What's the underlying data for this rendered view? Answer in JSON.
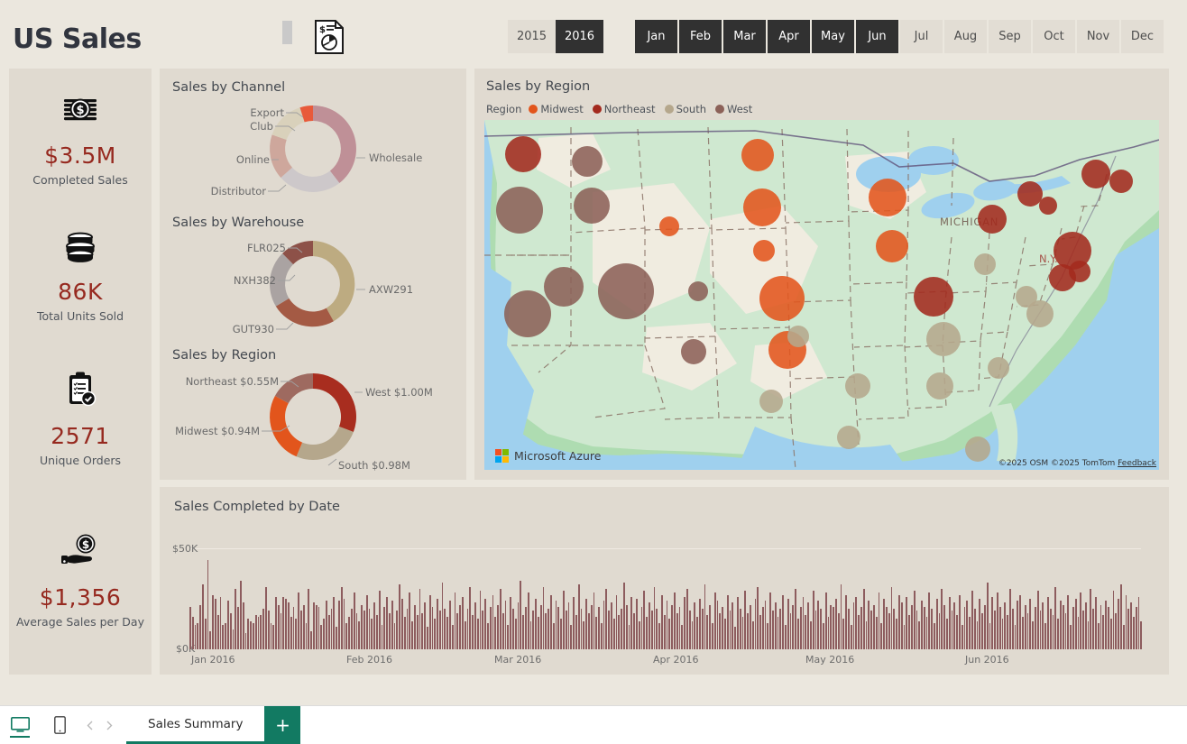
{
  "header": {
    "title": "US Sales",
    "report_icon": "report-document-icon",
    "year_slicer": [
      {
        "label": "2015",
        "selected": false
      },
      {
        "label": "2016",
        "selected": true
      }
    ],
    "month_slicer": [
      {
        "label": "Jan",
        "selected": true
      },
      {
        "label": "Feb",
        "selected": true
      },
      {
        "label": "Mar",
        "selected": true
      },
      {
        "label": "Apr",
        "selected": true
      },
      {
        "label": "May",
        "selected": true
      },
      {
        "label": "Jun",
        "selected": true
      },
      {
        "label": "Jul",
        "selected": false
      },
      {
        "label": "Aug",
        "selected": false
      },
      {
        "label": "Sep",
        "selected": false
      },
      {
        "label": "Oct",
        "selected": false
      },
      {
        "label": "Nov",
        "selected": false
      },
      {
        "label": "Dec",
        "selected": false
      }
    ]
  },
  "kpis": [
    {
      "icon": "money-stack-icon",
      "value": "$3.5M",
      "label": "Completed Sales"
    },
    {
      "icon": "coins-stack-icon",
      "value": "86K",
      "label": "Total Units Sold"
    },
    {
      "icon": "clipboard-check-icon",
      "value": "2571",
      "label": "Unique Orders"
    },
    {
      "icon": "hand-coin-icon",
      "value": "$1,356",
      "label": "Average Sales per Day"
    }
  ],
  "colors": {
    "kpi_value": "#96291f",
    "midwest": "#e2551c",
    "northeast": "#a32a1e",
    "south": "#b5a78c",
    "west": "#8c6158",
    "bar": "#8d5c5e",
    "accent_green": "#127a62",
    "panel_bg": "#e0dad0",
    "page_bg": "#ebe7de",
    "slicer_selected": "#313131"
  },
  "chart_data": [
    {
      "type": "pie",
      "title": "Sales by Channel",
      "legend_position": "callout-labels",
      "categories": [
        "Wholesale",
        "Distributor",
        "Online",
        "Club",
        "Export"
      ],
      "values": [
        44,
        16,
        16,
        15,
        9
      ],
      "colors": [
        "#bf9097",
        "#cdc8ca",
        "#cea79c",
        "#d9d1bb",
        "#e85a3a"
      ],
      "labels": [
        "Wholesale",
        "Distributor",
        "Online",
        "Club",
        "Export"
      ]
    },
    {
      "type": "pie",
      "title": "Sales by Warehouse",
      "legend_position": "callout-labels",
      "categories": [
        "AXW291",
        "GUT930",
        "NXH382",
        "FLR025"
      ],
      "values": [
        46,
        18,
        22,
        14
      ],
      "colors": [
        "#bdab81",
        "#a45a44",
        "#aaa3a2",
        "#8d5148"
      ],
      "labels": [
        "AXW291",
        "GUT930",
        "NXH382",
        "FLR025"
      ]
    },
    {
      "type": "pie",
      "title": "Sales by Region",
      "legend_position": "callout-labels",
      "categories": [
        "West",
        "South",
        "Midwest",
        "Northeast"
      ],
      "values": [
        1.0,
        0.98,
        0.94,
        0.55
      ],
      "unit": "$M",
      "colors": [
        "#a82d1f",
        "#b5a78c",
        "#e2551c",
        "#9e6a60"
      ],
      "labels": [
        "West $1.00M",
        "South $0.98M",
        "Midwest $0.94M",
        "Northeast $0.55M"
      ]
    },
    {
      "type": "bar",
      "title": "Sales Completed by Date",
      "xlabel": "",
      "ylabel": "",
      "ylim": [
        0,
        50000
      ],
      "ytick_labels": [
        "$0K",
        "$50K"
      ],
      "xtick_labels": [
        "Jan 2016",
        "Feb 2016",
        "Mar 2016",
        "Apr 2016",
        "May 2016",
        "Jun 2016"
      ],
      "grid": true,
      "bar_color": "#8d5c5e",
      "values": [
        21,
        16,
        12,
        13,
        22,
        32,
        15,
        44,
        9,
        27,
        25,
        17,
        26,
        12,
        13,
        24,
        18,
        10,
        30,
        21,
        34,
        23,
        8,
        15,
        14,
        13,
        17,
        16,
        17,
        20,
        31,
        19,
        13,
        12,
        26,
        22,
        18,
        26,
        25,
        23,
        16,
        21,
        15,
        28,
        19,
        22,
        13,
        30,
        9,
        23,
        22,
        21,
        12,
        15,
        24,
        17,
        20,
        26,
        11,
        24,
        31,
        25,
        13,
        16,
        20,
        28,
        18,
        14,
        22,
        19,
        27,
        20,
        15,
        23,
        17,
        29,
        12,
        21,
        26,
        18,
        24,
        13,
        19,
        32,
        25,
        16,
        20,
        28,
        14,
        22,
        17,
        30,
        18,
        23,
        11,
        27,
        21,
        15,
        25,
        19,
        33,
        20,
        16,
        24,
        12,
        28,
        18,
        22,
        26,
        14,
        20,
        31,
        17,
        23,
        15,
        29,
        19,
        25,
        13,
        21,
        27,
        16,
        22,
        30,
        18,
        24,
        12,
        26,
        20,
        15,
        23,
        34,
        17,
        21,
        28,
        14,
        19,
        25,
        16,
        22,
        31,
        18,
        20,
        27,
        13,
        24,
        21,
        15,
        29,
        19,
        23,
        12,
        26,
        17,
        32,
        20,
        14,
        25,
        18,
        22,
        28,
        16,
        21,
        13,
        24,
        30,
        19,
        23,
        15,
        27,
        17,
        20,
        33,
        22,
        12,
        26,
        18,
        25,
        14,
        21,
        29,
        16,
        23,
        19,
        31,
        20,
        13,
        27,
        17,
        24,
        15,
        22,
        28,
        18,
        21,
        12,
        26,
        30,
        19,
        14,
        23,
        16,
        25,
        20,
        32,
        17,
        22,
        13,
        28,
        24,
        18,
        21,
        15,
        27,
        19,
        23,
        11,
        26,
        20,
        16,
        29,
        18,
        22,
        14,
        25,
        31,
        17,
        21,
        24,
        13,
        28,
        19,
        23,
        16,
        20,
        27,
        12,
        25,
        18,
        22,
        30,
        15,
        21,
        26,
        17,
        23,
        14,
        29,
        19,
        24,
        20,
        13,
        28,
        16,
        22,
        21,
        25,
        18,
        32,
        15,
        27,
        20,
        12,
        23,
        26,
        17,
        21,
        30,
        14,
        24,
        19,
        22,
        16,
        28,
        13,
        25,
        21,
        18,
        31,
        20,
        15,
        27,
        23,
        12,
        26,
        17,
        22,
        29,
        19,
        14,
        24,
        21,
        16,
        28,
        20,
        13,
        25,
        18,
        30,
        22,
        15,
        26,
        19,
        23,
        17,
        27,
        12,
        21,
        24,
        16,
        29,
        20,
        14,
        25,
        18,
        22,
        33,
        13,
        26,
        19,
        28,
        21,
        15,
        23,
        17,
        30,
        20,
        12,
        24,
        27,
        16,
        22,
        18,
        25,
        14,
        21,
        29,
        19,
        23,
        13,
        26,
        20,
        17,
        31,
        15,
        24,
        22,
        18,
        27,
        12,
        21,
        25,
        16,
        28,
        19,
        23,
        14,
        30,
        20,
        26,
        13,
        22,
        17,
        24,
        21,
        15,
        29,
        18,
        25,
        32,
        12,
        27,
        20,
        23,
        16,
        21,
        26,
        14
      ]
    },
    {
      "type": "scatter",
      "title": "Sales by Region",
      "subtitle": "map",
      "legend_title": "Region",
      "legend": [
        {
          "label": "Midwest",
          "color": "#e2551c"
        },
        {
          "label": "Northeast",
          "color": "#a32a1e"
        },
        {
          "label": "South",
          "color": "#b5a78c"
        },
        {
          "label": "West",
          "color": "#8c6158"
        }
      ],
      "map_labels": [
        "MICHIGAN",
        "N.Y."
      ],
      "brand": "Microsoft Azure",
      "attribution": "©2025 OSM  ©2025 TomTom",
      "feedback_label": "Feedback",
      "bubbles": [
        {
          "x": 43,
          "y": 38,
          "r": 20,
          "region": "Northeast"
        },
        {
          "x": 39,
          "y": 100,
          "r": 26,
          "region": "West"
        },
        {
          "x": 114,
          "y": 46,
          "r": 17,
          "region": "West"
        },
        {
          "x": 119,
          "y": 95,
          "r": 20,
          "region": "West"
        },
        {
          "x": 205,
          "y": 118,
          "r": 11,
          "region": "Midwest"
        },
        {
          "x": 88,
          "y": 185,
          "r": 22,
          "region": "West"
        },
        {
          "x": 48,
          "y": 215,
          "r": 26,
          "region": "West"
        },
        {
          "x": 157,
          "y": 190,
          "r": 31,
          "region": "West"
        },
        {
          "x": 237,
          "y": 190,
          "r": 11,
          "region": "West"
        },
        {
          "x": 232,
          "y": 257,
          "r": 14,
          "region": "West"
        },
        {
          "x": 303,
          "y": 39,
          "r": 18,
          "region": "Midwest"
        },
        {
          "x": 308,
          "y": 97,
          "r": 21,
          "region": "Midwest"
        },
        {
          "x": 310,
          "y": 145,
          "r": 12,
          "region": "Midwest"
        },
        {
          "x": 330,
          "y": 198,
          "r": 25,
          "region": "Midwest"
        },
        {
          "x": 336,
          "y": 255,
          "r": 21,
          "region": "Midwest"
        },
        {
          "x": 318,
          "y": 312,
          "r": 13,
          "region": "South"
        },
        {
          "x": 348,
          "y": 240,
          "r": 12,
          "region": "South"
        },
        {
          "x": 414,
          "y": 295,
          "r": 14,
          "region": "South"
        },
        {
          "x": 404,
          "y": 352,
          "r": 13,
          "region": "South"
        },
        {
          "x": 447,
          "y": 86,
          "r": 21,
          "region": "Midwest"
        },
        {
          "x": 452,
          "y": 140,
          "r": 18,
          "region": "Midwest"
        },
        {
          "x": 498,
          "y": 196,
          "r": 22,
          "region": "Northeast"
        },
        {
          "x": 509,
          "y": 243,
          "r": 19,
          "region": "South"
        },
        {
          "x": 505,
          "y": 295,
          "r": 15,
          "region": "South"
        },
        {
          "x": 555,
          "y": 160,
          "r": 12,
          "region": "South"
        },
        {
          "x": 570,
          "y": 275,
          "r": 12,
          "region": "South"
        },
        {
          "x": 547,
          "y": 365,
          "r": 14,
          "region": "South"
        },
        {
          "x": 563,
          "y": 110,
          "r": 16,
          "region": "Northeast"
        },
        {
          "x": 605,
          "y": 82,
          "r": 14,
          "region": "Northeast"
        },
        {
          "x": 625,
          "y": 95,
          "r": 10,
          "region": "Northeast"
        },
        {
          "x": 652,
          "y": 145,
          "r": 21,
          "region": "Northeast"
        },
        {
          "x": 641,
          "y": 175,
          "r": 15,
          "region": "Northeast"
        },
        {
          "x": 660,
          "y": 168,
          "r": 12,
          "region": "Northeast"
        },
        {
          "x": 678,
          "y": 60,
          "r": 16,
          "region": "Northeast"
        },
        {
          "x": 706,
          "y": 68,
          "r": 13,
          "region": "Northeast"
        },
        {
          "x": 616,
          "y": 215,
          "r": 15,
          "region": "South"
        },
        {
          "x": 601,
          "y": 196,
          "r": 12,
          "region": "South"
        }
      ]
    }
  ],
  "donuts": {
    "channel": {
      "title": "Sales by Channel",
      "labels": [
        {
          "text": "Export",
          "side": "left",
          "top": 16,
          "x": 100
        },
        {
          "text": "Club",
          "side": "left",
          "top": 31,
          "x": 88
        },
        {
          "text": "Online",
          "side": "left",
          "top": 68,
          "x": 80
        },
        {
          "text": "Distributor",
          "side": "left",
          "top": 104,
          "x": 62
        },
        {
          "text": "Wholesale",
          "side": "right",
          "top": 66,
          "x": 228
        }
      ]
    },
    "warehouse": {
      "title": "Sales by Warehouse",
      "labels": [
        {
          "text": "FLR025",
          "side": "left",
          "top": 16,
          "x": 92
        },
        {
          "text": "NXH382",
          "side": "left",
          "top": 52,
          "x": 82
        },
        {
          "text": "GUT930",
          "side": "left",
          "top": 108,
          "x": 82
        },
        {
          "text": "AXW291",
          "side": "right",
          "top": 62,
          "x": 228
        }
      ]
    },
    "region": {
      "title": "Sales by Region",
      "labels": [
        {
          "text": "Northeast $0.55M",
          "side": "left",
          "top": 17,
          "x": 130
        },
        {
          "text": "Midwest $0.94M",
          "side": "left",
          "top": 72,
          "x": 102
        },
        {
          "text": "South $0.98M",
          "side": "right",
          "top": 110,
          "x": 191
        },
        {
          "text": "West $1.00M",
          "side": "right",
          "top": 29,
          "x": 214
        }
      ]
    }
  },
  "time_chart": {
    "title": "Sales Completed by Date",
    "y_top": "$50K",
    "y_bottom": "$0K",
    "x_ticks": [
      "Jan 2016",
      "Feb 2016",
      "Mar 2016",
      "Apr 2016",
      "May 2016",
      "Jun 2016"
    ]
  },
  "bottom_bar": {
    "desktop_icon": "desktop-view-icon",
    "mobile_icon": "mobile-view-icon",
    "prev_icon": "chevron-left-icon",
    "next_icon": "chevron-right-icon",
    "tabs": [
      {
        "label": "Sales Summary",
        "active": true
      }
    ],
    "add_label": "+"
  }
}
